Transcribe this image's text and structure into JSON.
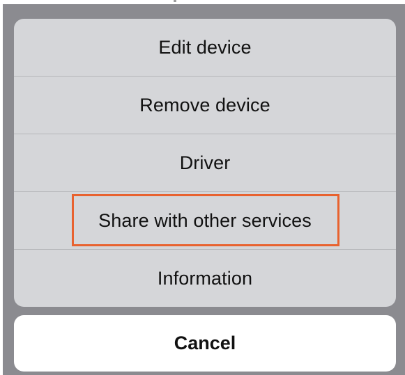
{
  "action_sheet": {
    "items": [
      {
        "label": "Edit device"
      },
      {
        "label": "Remove device"
      },
      {
        "label": "Driver"
      },
      {
        "label": "Share with other services",
        "highlighted": true
      },
      {
        "label": "Information"
      }
    ],
    "cancel_label": "Cancel",
    "highlight_color": "#e8622f"
  }
}
